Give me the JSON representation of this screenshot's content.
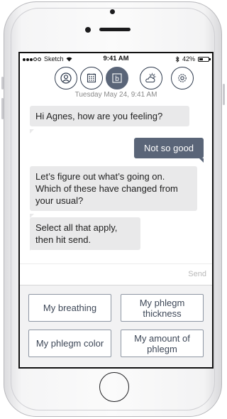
{
  "status_bar": {
    "carrier": "Sketch",
    "time": "9:41 AM",
    "battery_text": "42%",
    "battery_level": 0.42,
    "signal_icon": "signal-dots-icon",
    "wifi_icon": "wifi-icon",
    "bluetooth_icon": "bluetooth-icon"
  },
  "nav": {
    "items": [
      {
        "icon": "user-icon"
      },
      {
        "icon": "calendar-grid-icon"
      },
      {
        "icon": "b-logo-icon",
        "letter": "b",
        "active": true
      },
      {
        "icon": "weather-partly-cloudy-icon"
      },
      {
        "icon": "settings-icon"
      }
    ]
  },
  "chat": {
    "date_header": "Tuesday May 24, 9:41 AM",
    "messages": [
      {
        "from": "bot",
        "text": "Hi Agnes, how are you feeling?"
      },
      {
        "from": "user",
        "text": "Not so good"
      },
      {
        "from": "bot",
        "text": "Let’s figure out what’s going on. Which of these have changed from your usual?"
      },
      {
        "from": "bot",
        "text": "Select all that apply, then hit send."
      }
    ]
  },
  "composer": {
    "send_label": "Send"
  },
  "options": [
    {
      "label": "My breathing"
    },
    {
      "label": "My phlegm thickness"
    },
    {
      "label": "My phlegm color"
    },
    {
      "label": "My amount of phlegm"
    }
  ],
  "colors": {
    "accent": "#5a6578",
    "bubble_incoming": "#e9e9ea",
    "option_border": "#8e96a3"
  }
}
